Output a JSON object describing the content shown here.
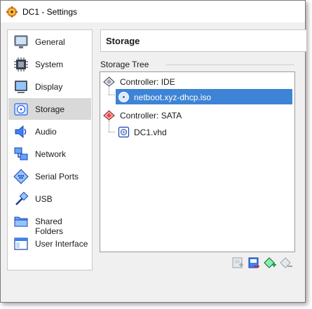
{
  "window": {
    "title": "DC1 - Settings"
  },
  "sidebar": {
    "items": [
      {
        "label": "General",
        "icon": "monitor-icon",
        "selected": false
      },
      {
        "label": "System",
        "icon": "chip-icon",
        "selected": false
      },
      {
        "label": "Display",
        "icon": "display-icon",
        "selected": false
      },
      {
        "label": "Storage",
        "icon": "storage-disc-icon",
        "selected": true
      },
      {
        "label": "Audio",
        "icon": "speaker-icon",
        "selected": false
      },
      {
        "label": "Network",
        "icon": "network-icon",
        "selected": false
      },
      {
        "label": "Serial Ports",
        "icon": "serial-port-icon",
        "selected": false
      },
      {
        "label": "USB",
        "icon": "usb-icon",
        "selected": false
      },
      {
        "label": "Shared Folders",
        "icon": "folder-icon",
        "selected": false
      },
      {
        "label": "User Interface",
        "icon": "window-icon",
        "selected": false
      }
    ]
  },
  "page": {
    "title": "Storage",
    "tree_group_label": "Storage Tree",
    "tree": [
      {
        "type": "controller",
        "label": "Controller: IDE",
        "icon": "ide-controller-icon"
      },
      {
        "type": "device",
        "label": "netboot.xyz-dhcp.iso",
        "icon": "optical-disc-icon",
        "selected": true
      },
      {
        "type": "controller",
        "label": "Controller: SATA",
        "icon": "sata-controller-icon"
      },
      {
        "type": "device",
        "label": "DC1.vhd",
        "icon": "hard-disk-icon",
        "selected": false
      }
    ]
  },
  "toolbar": {
    "buttons": [
      "add-attachment-icon",
      "remove-attachment-icon",
      "add-controller-icon",
      "remove-controller-icon"
    ]
  },
  "colors": {
    "selection": "#3d84d6",
    "sidebar_selected": "#d9d9d9",
    "window_bg": "#f0f0f0"
  }
}
